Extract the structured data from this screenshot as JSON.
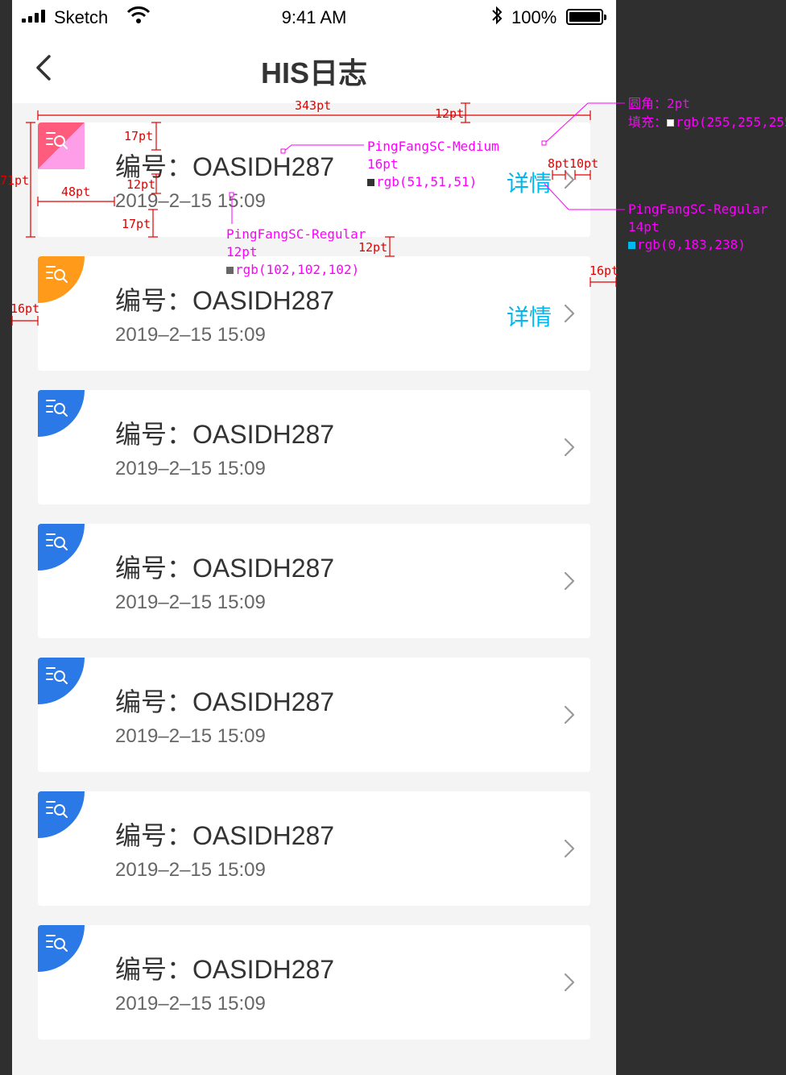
{
  "status_bar": {
    "carrier": "Sketch",
    "time": "9:41 AM",
    "battery": "100%"
  },
  "header": {
    "title": "HIS日志"
  },
  "colors": {
    "accent_detail": "#00b7ee",
    "title_text": "#333333",
    "date_text": "#666666",
    "badge_blue": "#2a79e6",
    "badge_orange": "#ff9a1a",
    "annotation": "#ff00ff",
    "dimension": "#e00000"
  },
  "logs": [
    {
      "title": "编号：OASIDH287",
      "date": "2019–2–15 15:09",
      "detail": "详情",
      "badge": "pink",
      "icon": "log-search-icon"
    },
    {
      "title": "编号：OASIDH287",
      "date": "2019–2–15 15:09",
      "detail": "详情",
      "badge": "orange",
      "icon": "log-search-icon"
    },
    {
      "title": "编号：OASIDH287",
      "date": "2019–2–15 15:09",
      "detail": "",
      "badge": "blue",
      "icon": "log-search-icon"
    },
    {
      "title": "编号：OASIDH287",
      "date": "2019–2–15 15:09",
      "detail": "",
      "badge": "blue",
      "icon": "log-search-icon"
    },
    {
      "title": "编号：OASIDH287",
      "date": "2019–2–15 15:09",
      "detail": "",
      "badge": "blue",
      "icon": "log-search-icon"
    },
    {
      "title": "编号：OASIDH287",
      "date": "2019–2–15 15:09",
      "detail": "",
      "badge": "blue",
      "icon": "log-search-icon"
    },
    {
      "title": "编号：OASIDH287",
      "date": "2019–2–15 15:09",
      "detail": "",
      "badge": "blue",
      "icon": "log-search-icon"
    }
  ],
  "annotations": {
    "radius_label": "圆角：2pt",
    "fill_label": "填充：",
    "fill_value": "rgb(255,255,255)",
    "title_font": "PingFangSC-Medium",
    "title_size": "16pt",
    "title_color": "rgb(51,51,51)",
    "date_font": "PingFangSC-Regular",
    "date_size": "12pt",
    "date_color": "rgb(102,102,102)",
    "detail_font": "PingFangSC-Regular",
    "detail_size": "14pt",
    "detail_color": "rgb(0,183,238)",
    "dims": {
      "width": "343pt",
      "gap_right": "12pt",
      "top_pad": "17pt",
      "line_gap": "12pt",
      "bottom_pad": "17pt",
      "left_text": "48pt",
      "card_height": "71pt",
      "chev_gap": "8pt",
      "chev_right": "10pt",
      "card_gap": "12pt",
      "side_margin_right": "16pt",
      "side_margin_left": "16pt"
    }
  }
}
